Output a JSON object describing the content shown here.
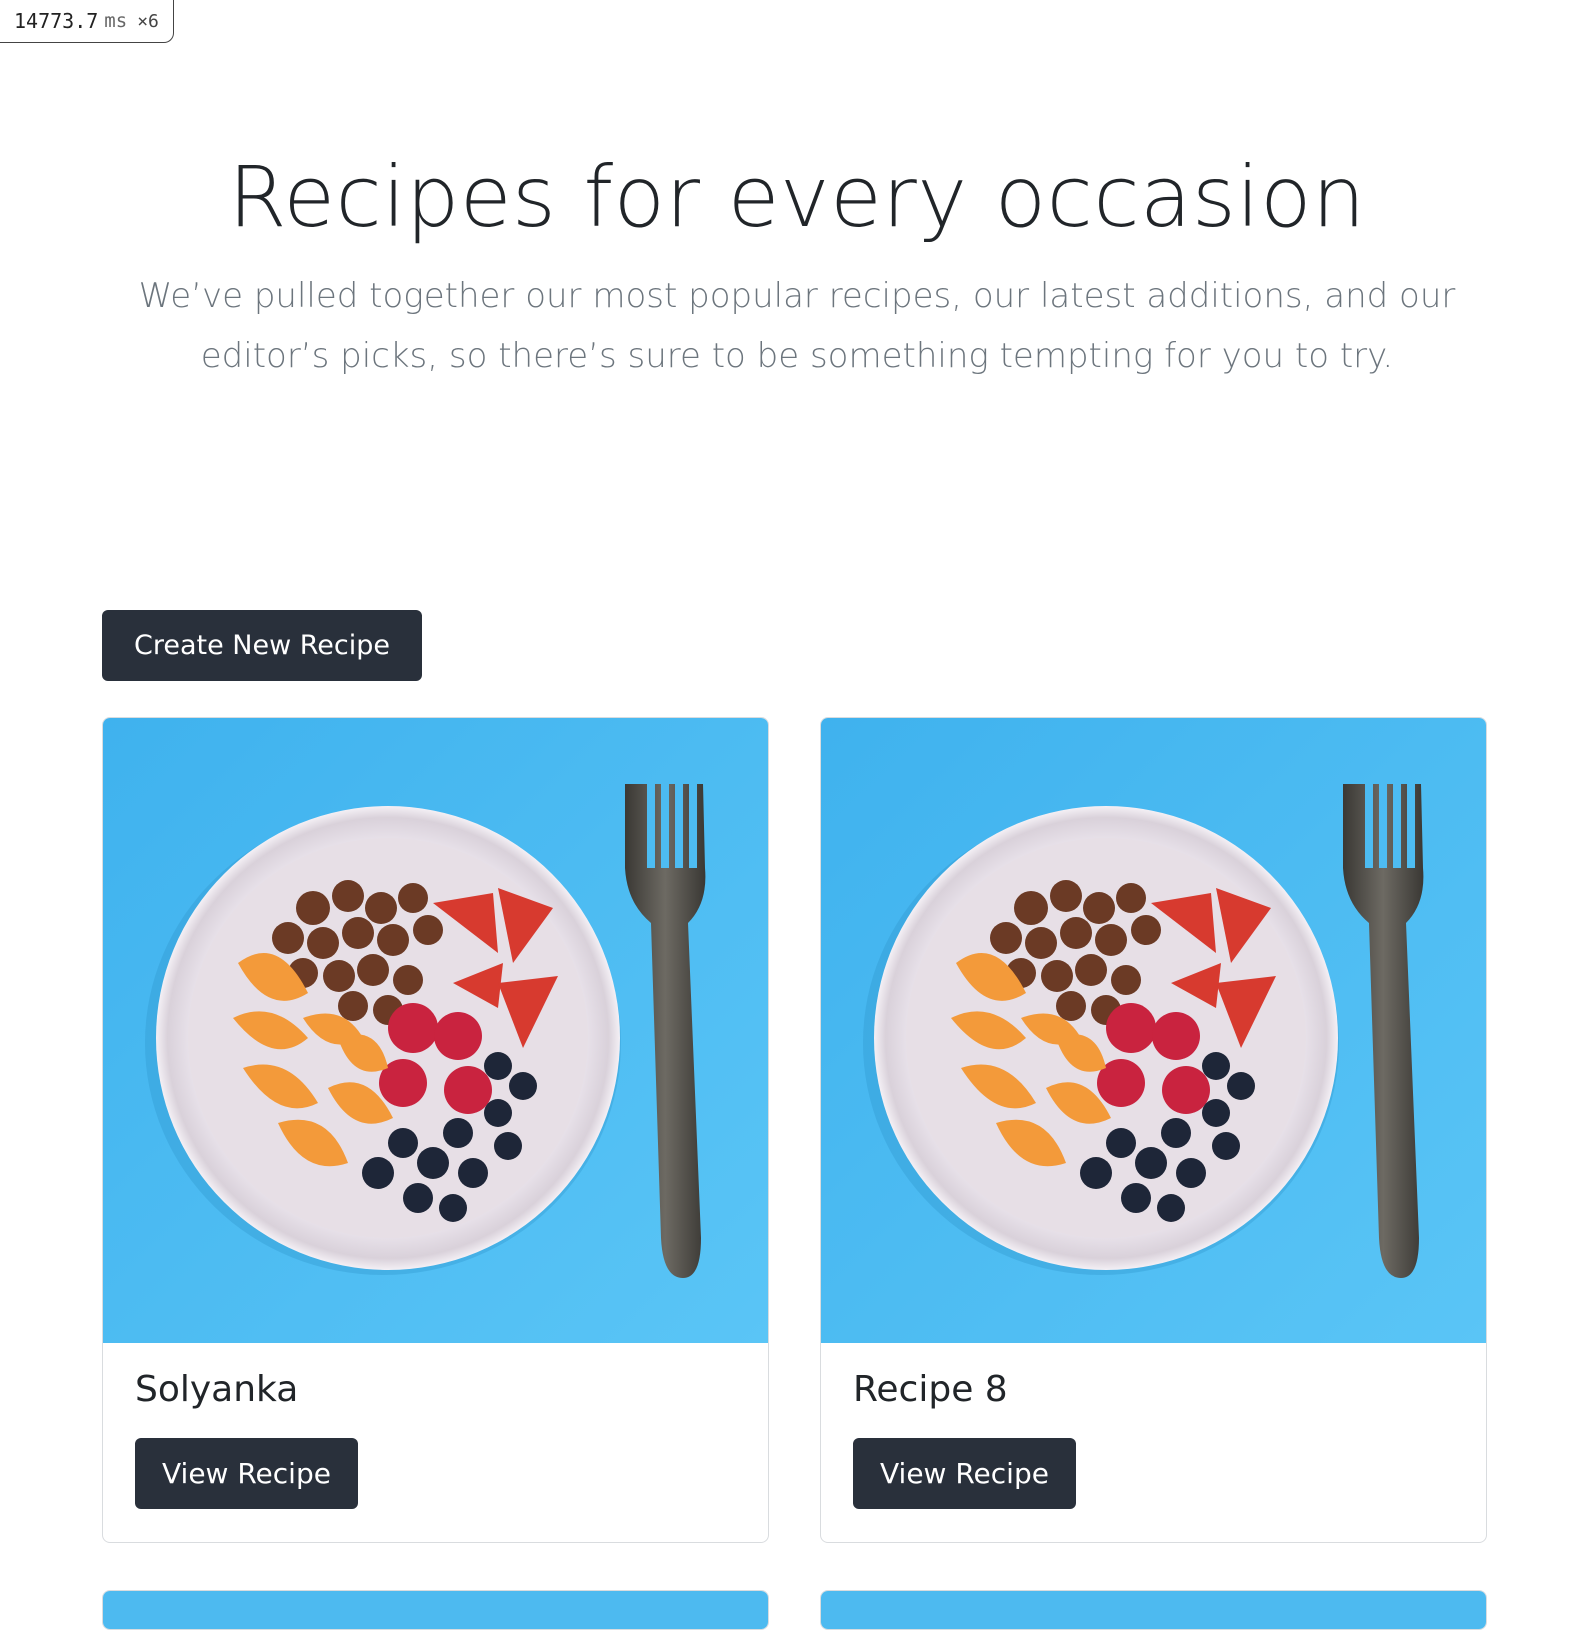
{
  "perf": {
    "value": "14773.7",
    "unit": "ms",
    "multiplier": "×6"
  },
  "hero": {
    "title": "Recipes for every occasion",
    "lead": "We’ve pulled together our most popular recipes, our latest additions, and our editor’s picks, so there’s sure to be something tempting for you to try."
  },
  "actions": {
    "create_label": "Create New Recipe"
  },
  "recipes": [
    {
      "title": "Solyanka",
      "button_label": "View Recipe"
    },
    {
      "title": "Recipe 8",
      "button_label": "View Recipe"
    }
  ],
  "colors": {
    "button_bg": "#29303b",
    "image_bg": "#4dbaf0",
    "muted_text": "#6c757d"
  }
}
